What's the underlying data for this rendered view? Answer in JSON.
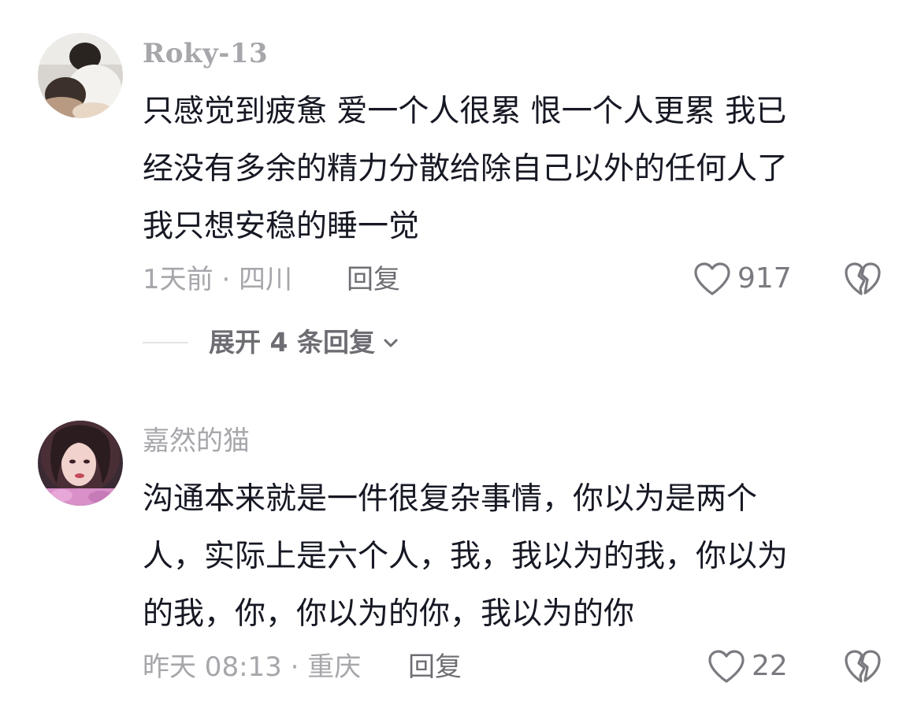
{
  "comments": [
    {
      "username": "Roky-13",
      "text_lines": [
        "只感觉到疲惫 爱一个人很累 恨一个人更累 我已",
        "经没有多余的精力分散给除自己以外的任何人了",
        "我只想安稳的睡一觉"
      ],
      "meta": "1天前 · 四川",
      "reply_label": "回复",
      "likes": "917",
      "expand_label": "展开 4 条回复"
    },
    {
      "username": "嘉然的猫",
      "text_lines": [
        "沟通本来就是一件很复杂事情，你以为是两个",
        "人，实际上是六个人，我，我以为的我，你以为",
        "的我，你，你以为的你，我以为的你"
      ],
      "meta": "昨天 08:13 · 重庆",
      "reply_label": "回复",
      "likes": "22"
    }
  ],
  "icons": {
    "like": "heart-outline-icon",
    "dislike": "broken-heart-icon",
    "expand": "chevron-down-icon"
  },
  "colors": {
    "text": "#161823",
    "secondary": "#a6a6ab",
    "action": "#6d6d73"
  }
}
